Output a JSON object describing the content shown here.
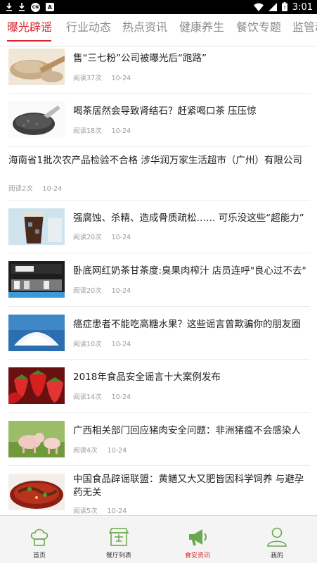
{
  "status_bar": {
    "time": "3:01",
    "left_icons": [
      "download-icon",
      "download-icon",
      "cn-badge-icon",
      "a-badge-icon"
    ],
    "cn_badge": "CN",
    "a_badge": "A",
    "right_icons": [
      "wifi-icon",
      "signal-icon",
      "battery-icon"
    ]
  },
  "tabs": [
    {
      "label": "曝光辟谣",
      "active": true
    },
    {
      "label": "行业动态",
      "active": false
    },
    {
      "label": "热点资讯",
      "active": false
    },
    {
      "label": "健康养生",
      "active": false
    },
    {
      "label": "餐饮专题",
      "active": false
    },
    {
      "label": "监管动",
      "active": false
    }
  ],
  "articles": [
    {
      "title": "售“三七粉”公司被曝光后“跑路”",
      "reads": "阅读37次",
      "date": "10-24",
      "thumb": "powder-spoon-image"
    },
    {
      "title": "喝茶居然会导致肾结石？赶紧喝口茶 压压惊",
      "reads": "阅读18次",
      "date": "10-24",
      "thumb": "tea-leaves-image"
    },
    {
      "title": "海南省1批次农产品检验不合格  涉华润万家生活超市（广州）有限公司",
      "reads": "阅读2次",
      "date": "10-24",
      "thumb": null
    },
    {
      "title": "强腐蚀、杀精、造成骨质疏松…… 可乐没这些“超能力”",
      "reads": "阅读20次",
      "date": "10-24",
      "thumb": "cola-glass-image"
    },
    {
      "title": "卧底网红奶茶甘茶度:臭果肉榨汁 店员连呼\"良心过不去\"",
      "reads": "阅读20次",
      "date": "10-24",
      "thumb": "tea-shop-image"
    },
    {
      "title": "癌症患者不能吃高糖水果？这些谣言曾欺骗你的朋友圈",
      "reads": "阅读10次",
      "date": "10-24",
      "thumb": "sugar-pile-image"
    },
    {
      "title": "2018年食品安全谣言十大案例发布",
      "reads": "阅读14次",
      "date": "10-24",
      "thumb": "strawberries-image"
    },
    {
      "title": "广西相关部门回应猪肉安全问题：非洲猪瘟不会感染人",
      "reads": "阅读4次",
      "date": "10-24",
      "thumb": "pig-image"
    },
    {
      "title": "中国食品辟谣联盟：黄鳝又大又肥皆因科学饲养 与避孕药无关",
      "reads": "阅读5次",
      "date": "10-24",
      "thumb": "eel-dish-image"
    }
  ],
  "bottom_nav": [
    {
      "label": "首页",
      "icon": "chef-hat-icon",
      "active": false
    },
    {
      "label": "餐厅列表",
      "icon": "restaurant-store-icon",
      "active": false
    },
    {
      "label": "食安资讯",
      "icon": "megaphone-icon",
      "active": true
    },
    {
      "label": "我的",
      "icon": "user-icon",
      "active": false
    }
  ],
  "colors": {
    "accent": "#d9232d",
    "icon_green": "#6aa84f",
    "text": "#222222",
    "muted": "#9b9b9b"
  }
}
